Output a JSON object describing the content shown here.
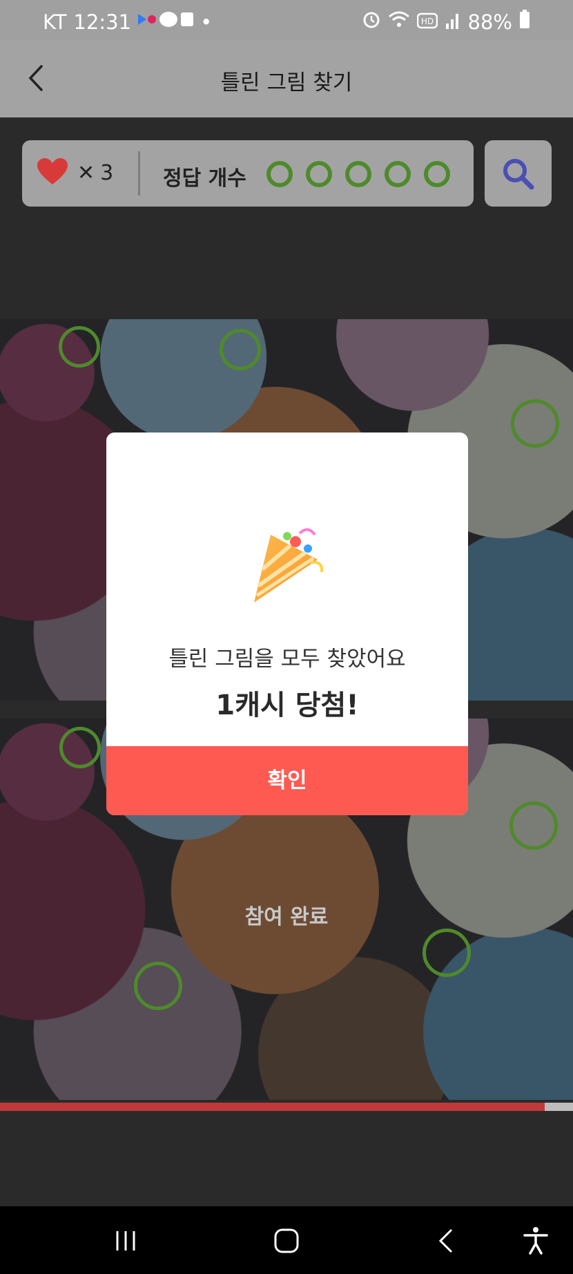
{
  "status_bar": {
    "carrier": "KT",
    "time": "12:31",
    "battery": "88%"
  },
  "header": {
    "title": "틀린 그림 찾기",
    "back_icon": "chevron-left-icon"
  },
  "game": {
    "lives_count": "3",
    "lives_prefix": "✕",
    "answers_label": "정답 개수",
    "answers_found": 5,
    "answers_total": 5,
    "ring_color": "#4e8a2b",
    "search_icon": "search-icon",
    "completed_text": "참여 완료",
    "progress_fraction": 0.95
  },
  "modal": {
    "icon": "party-popper-icon",
    "message": "틀린 그림을 모두 찾았어요",
    "prize": "1캐시 당첨!",
    "confirm_label": "확인",
    "accent_color": "#ff5a52"
  }
}
